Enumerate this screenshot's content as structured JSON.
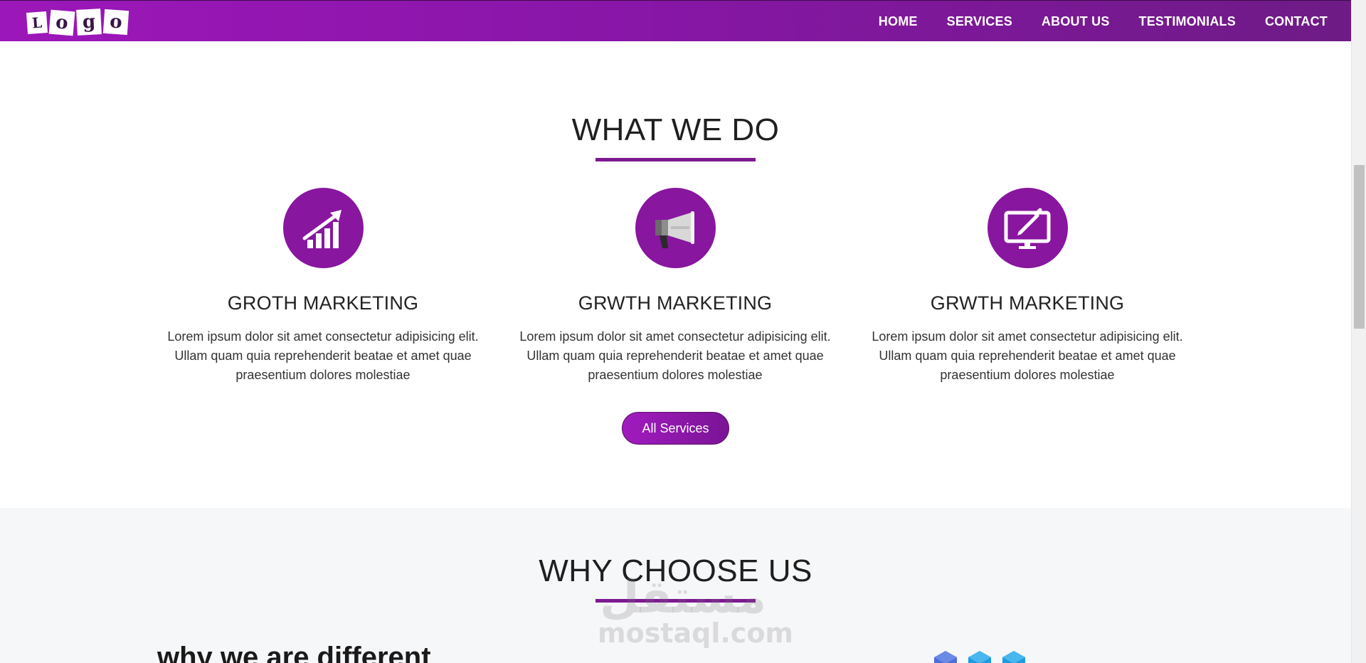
{
  "navbar": {
    "logo_letters": [
      "L",
      "o",
      "g",
      "o"
    ],
    "links": [
      "HOME",
      "SERVICES",
      "ABOUT US",
      "TESTIMONIALS",
      "CONTACT"
    ]
  },
  "what_we_do": {
    "title": "WHAT WE DO",
    "services": [
      {
        "icon": "growth-chart-icon",
        "title": "GROTH MARKETING",
        "text": "Lorem ipsum dolor sit amet consectetur adipisicing elit. Ullam quam quia reprehenderit beatae et amet quae praesentium dolores molestiae"
      },
      {
        "icon": "megaphone-icon",
        "title": "GRWTH MARKETING",
        "text": "Lorem ipsum dolor sit amet consectetur adipisicing elit. Ullam quam quia reprehenderit beatae et amet quae praesentium dolores molestiae"
      },
      {
        "icon": "monitor-pen-icon",
        "title": "GRWTH MARKETING",
        "text": "Lorem ipsum dolor sit amet consectetur adipisicing elit. Ullam quam quia reprehenderit beatae et amet quae praesentium dolores molestiae"
      }
    ],
    "button_label": "All Services"
  },
  "why_choose_us": {
    "title": "WHY CHOOSE US",
    "subheading": "why we are different"
  },
  "watermark": {
    "arabic": "مستقل",
    "latin": "mostaql.com"
  },
  "colors": {
    "brand_purple": "#88169f",
    "nav_gradient_start": "#9c17b9",
    "nav_gradient_end": "#6e1b86",
    "section_gray": "#f6f7f9"
  }
}
